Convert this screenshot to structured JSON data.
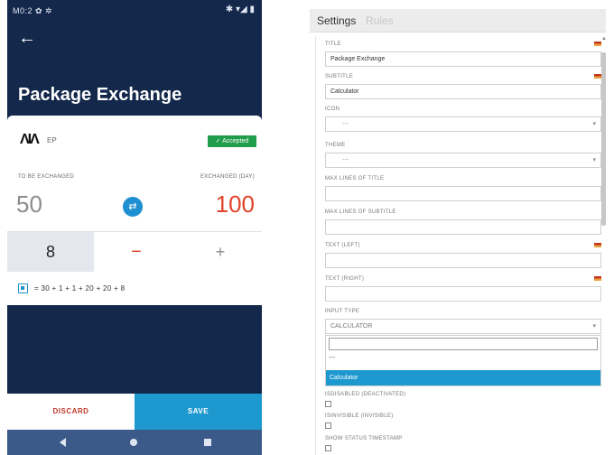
{
  "phone": {
    "status_left": "M0:2 ✿ ✲",
    "status_right": "✱ ▾◢ ▮",
    "back_icon": "arrow-left-icon",
    "title": "Package Exchange",
    "package": {
      "icon": "pallet-icon",
      "icon_glyph": "ΛΙΛ",
      "code": "EP",
      "badge": "✓ Accepted"
    },
    "to_exchange_label": "TO BE EXCHANGED",
    "exchanged_label": "EXCHANGED (DAY)",
    "to_exchange_value": "50",
    "exchanged_value": "100",
    "swap_icon": "swap-arrows-icon",
    "swap_glyph": "⇄",
    "quantity": "8",
    "minus": "−",
    "plus": "+",
    "calc_icon": "calculator-icon",
    "formula": "= 30 + 1 + 1 + 20 + 20 + 8",
    "discard_label": "DISCARD",
    "save_label": "SAVE",
    "nav": [
      "back-triangle-icon",
      "home-circle-icon",
      "recents-square-icon"
    ]
  },
  "settings": {
    "tabs": [
      "Settings",
      "Rules"
    ],
    "fields": {
      "title_label": "TITLE",
      "title_value": "Package Exchange",
      "subtitle_label": "SUBTITLE",
      "subtitle_value": "Calculator",
      "icon_label": "ICON",
      "icon_value": "---",
      "theme_label": "THEME",
      "theme_value": "---",
      "max_title_label": "MAX LINES OF TITLE",
      "max_subtitle_label": "MAX LINES OF SUBTITLE",
      "text_left_label": "TEXT (LEFT)",
      "text_right_label": "TEXT (RIGHT)",
      "input_type_label": "INPUT TYPE",
      "input_type_value": "CALCULATOR",
      "dropdown_empty": "---",
      "dropdown_selected": "Calculator",
      "disabled_label": "ISDISABLED (DEACTIVATED)",
      "invisible_label": "ISINVISIBLE (INVISIBLE)",
      "timestamp_label": "SHOW STATUS TIMESTAMP"
    },
    "caret": "▾"
  },
  "colors": {
    "phone_bg": "#14284b",
    "accent_blue": "#1e99cf",
    "accent_red": "#e1432b",
    "accepted_green": "#1f9d4a"
  }
}
